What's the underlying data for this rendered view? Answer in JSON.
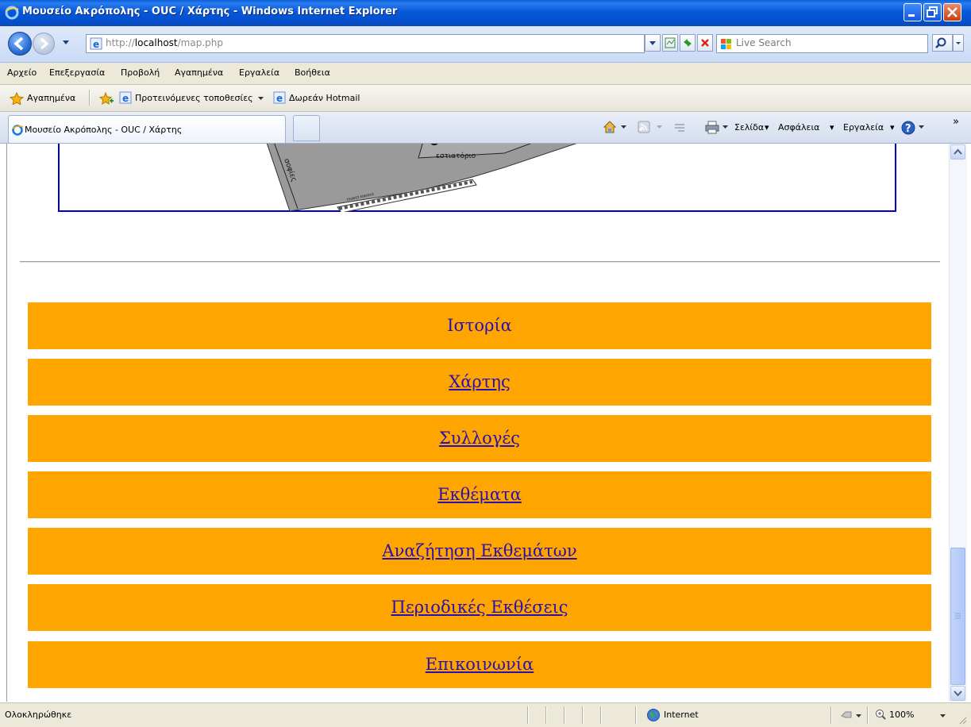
{
  "window": {
    "title": "Μουσείο Ακρόπολης - OUC / Χάρτης - Windows Internet Explorer"
  },
  "address": {
    "url_prefix": "http://",
    "url_host": "localhost",
    "url_path": "/map.php",
    "search_placeholder": "Live Search"
  },
  "menu": {
    "items": [
      "Αρχείο",
      "Επεξεργασία",
      "Προβολή",
      "Αγαπημένα",
      "Εργαλεία",
      "Βοήθεια"
    ]
  },
  "favorites": {
    "label": "Αγαπημένα",
    "suggested": "Προτεινόμενες τοποθεσίες",
    "hotmail": "Δωρεάν Hotmail"
  },
  "tabs": {
    "active": "Μουσείο Ακρόπολης - OUC / Χάρτης"
  },
  "commandbar": {
    "page": "Σελίδα",
    "safety": "Ασφάλεια",
    "tools": "Εργαλεία"
  },
  "map": {
    "labels": [
      "εστιατόριο",
      "σοφίες",
      "ΠΛΑΚΕΣ ΚΙΝΗΣΗΣ"
    ]
  },
  "nav": {
    "items": [
      {
        "label": "Ιστορία",
        "link": false
      },
      {
        "label": "Χάρτης",
        "link": true
      },
      {
        "label": "Συλλογές",
        "link": true
      },
      {
        "label": "Εκθέματα",
        "link": true
      },
      {
        "label": "Αναζήτηση Εκθεμάτων",
        "link": true
      },
      {
        "label": "Περιοδικές Εκθέσεις",
        "link": true
      },
      {
        "label": "Επικοινωνία",
        "link": true
      }
    ]
  },
  "status": {
    "text": "Ολοκληρώθηκε",
    "zone": "Internet",
    "zoom": "100%"
  },
  "colors": {
    "nav_bg": "#ffa500",
    "nav_text": "#2a10b0",
    "map_border": "#0000cc"
  }
}
